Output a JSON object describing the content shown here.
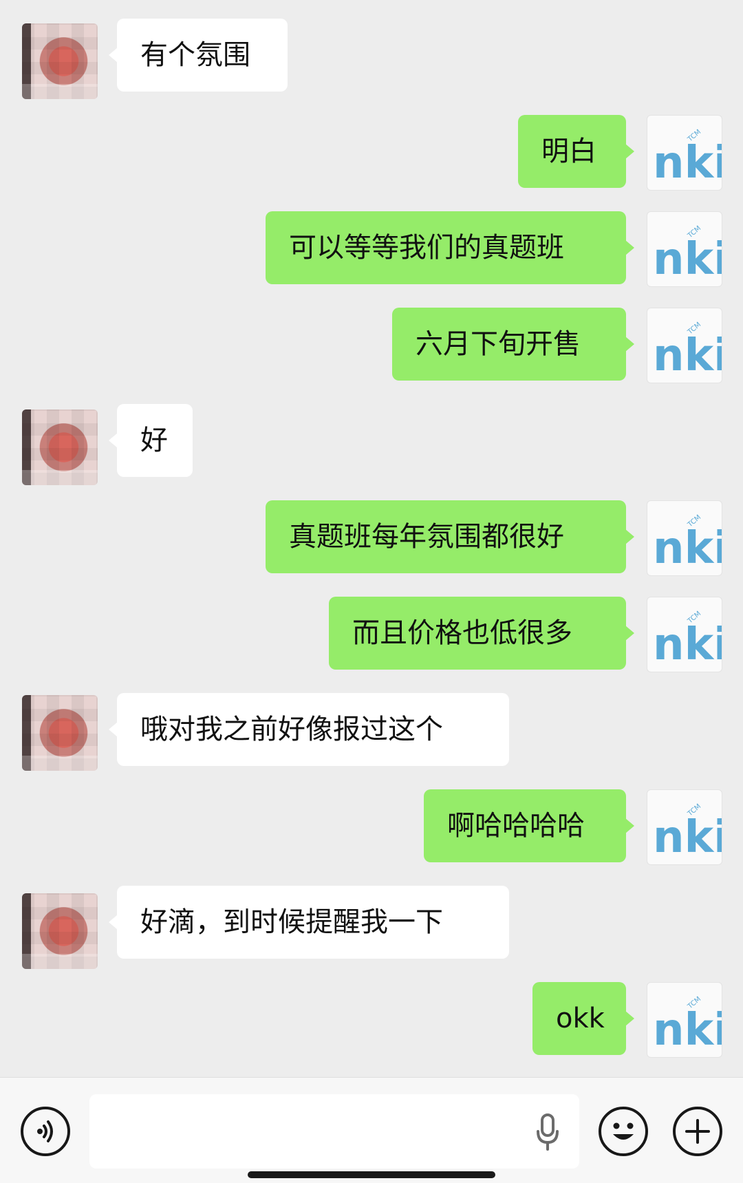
{
  "chat": {
    "messages": [
      {
        "side": "in",
        "text": "有个氛围"
      },
      {
        "side": "out",
        "text": "明白"
      },
      {
        "side": "out",
        "text": "可以等等我们的真题班"
      },
      {
        "side": "out",
        "text": "六月下旬开售"
      },
      {
        "side": "in",
        "text": "好"
      },
      {
        "side": "out",
        "text": "真题班每年氛围都很好"
      },
      {
        "side": "out",
        "text": "而且价格也低很多"
      },
      {
        "side": "in",
        "text": "哦对我之前好像报过这个"
      },
      {
        "side": "out",
        "text": "啊哈哈哈哈"
      },
      {
        "side": "in",
        "text": "好滴，到时候提醒我一下"
      },
      {
        "side": "out",
        "text": "okk"
      }
    ]
  },
  "brand_avatar": {
    "logo_text": "nki",
    "logo_small_text": "TCM",
    "color": "#5aa9d6"
  },
  "colors": {
    "background": "#ededed",
    "incoming_bubble": "#ffffff",
    "outgoing_bubble": "#95ec69"
  },
  "input_bar": {
    "voice_icon": "voice-mode-icon",
    "mic_icon": "microphone-icon",
    "emoji_icon": "emoji-icon",
    "plus_icon": "plus-icon",
    "text_value": ""
  }
}
